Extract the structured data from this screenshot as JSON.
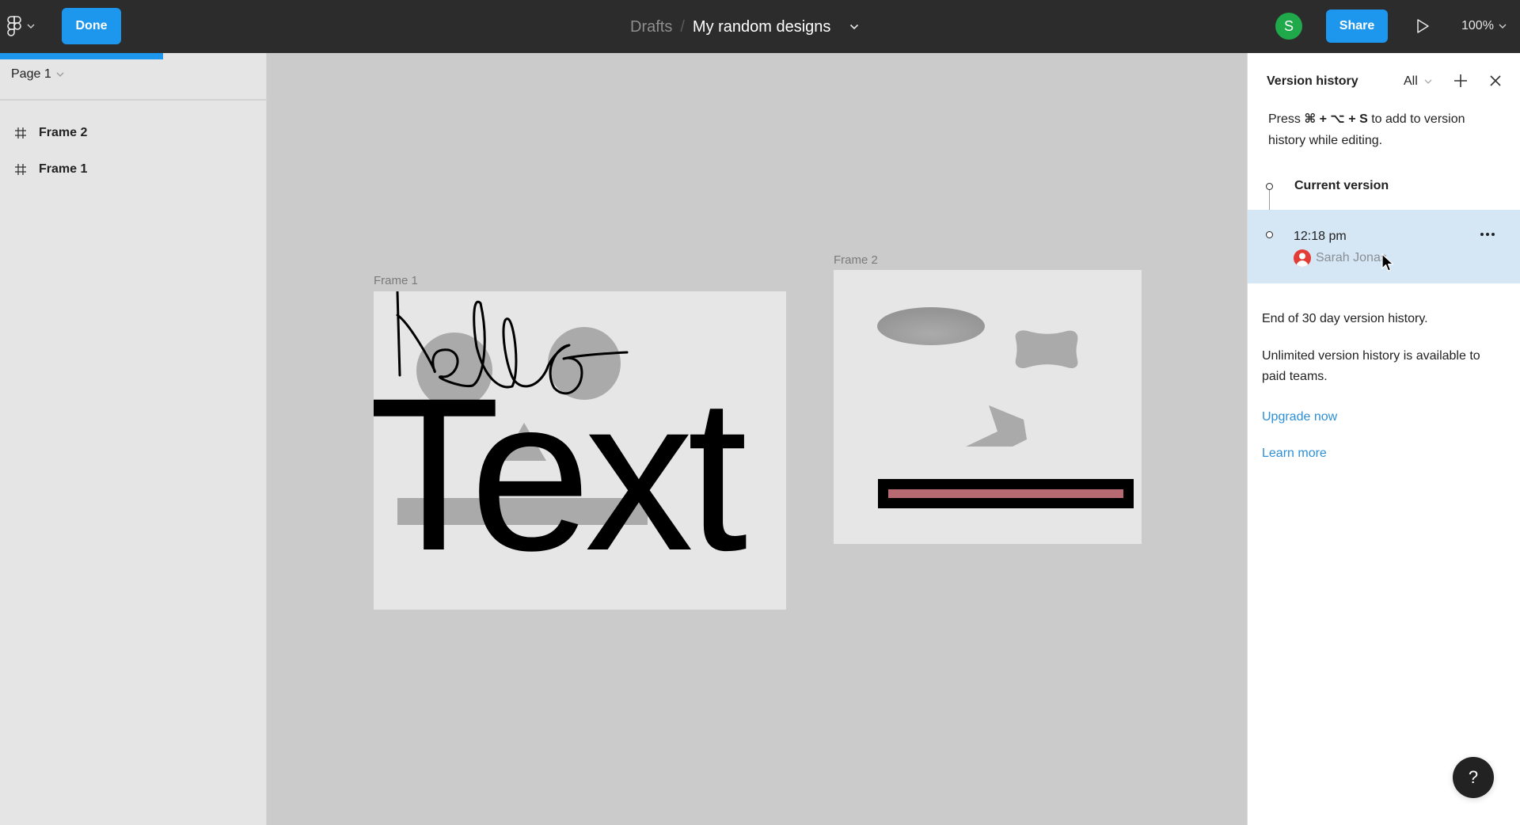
{
  "topbar": {
    "logo_icon": "figma-logo-icon",
    "done_label": "Done",
    "breadcrumb": {
      "parent": "Drafts",
      "separator": "/",
      "title": "My random designs"
    },
    "avatar_initial": "S",
    "share_label": "Share",
    "zoom_level": "100%"
  },
  "loading_progress": 0.61,
  "sidebar": {
    "page_selector": "Page 1",
    "layers": [
      {
        "name": "Frame 2",
        "icon": "frame-hash-icon"
      },
      {
        "name": "Frame 1",
        "icon": "frame-hash-icon"
      }
    ]
  },
  "canvas": {
    "frames": [
      {
        "label": "Frame 1",
        "big_text": "Text",
        "handwriting": "hello"
      },
      {
        "label": "Frame 2"
      }
    ],
    "colors": {
      "background": "#cbcbcb",
      "frame_fill": "#e6e6e6",
      "shape_gray": "#aaaaaa",
      "bar_pink": "#b86a72",
      "bar_border": "#000000"
    }
  },
  "version_panel": {
    "title": "Version history",
    "filter": "All",
    "hint_prefix": "Press ",
    "hint_keys": "⌘ + ⌥ + S",
    "hint_suffix": " to add to version history while editing.",
    "current_version_label": "Current version",
    "versions": [
      {
        "time": "12:18 pm",
        "user": "Sarah Jonas"
      }
    ],
    "end_note": "End of 30 day version history.",
    "unlimited_note": "Unlimited version history is available to paid teams.",
    "upgrade_link": "Upgrade now",
    "learn_more_link": "Learn more"
  },
  "help_label": "?",
  "colors": {
    "accent": "#1d96ed",
    "topbar": "#2c2c2c",
    "avatar_green": "#1fa94a",
    "selected_row": "#d5e6f4",
    "link": "#2d8fd6"
  }
}
